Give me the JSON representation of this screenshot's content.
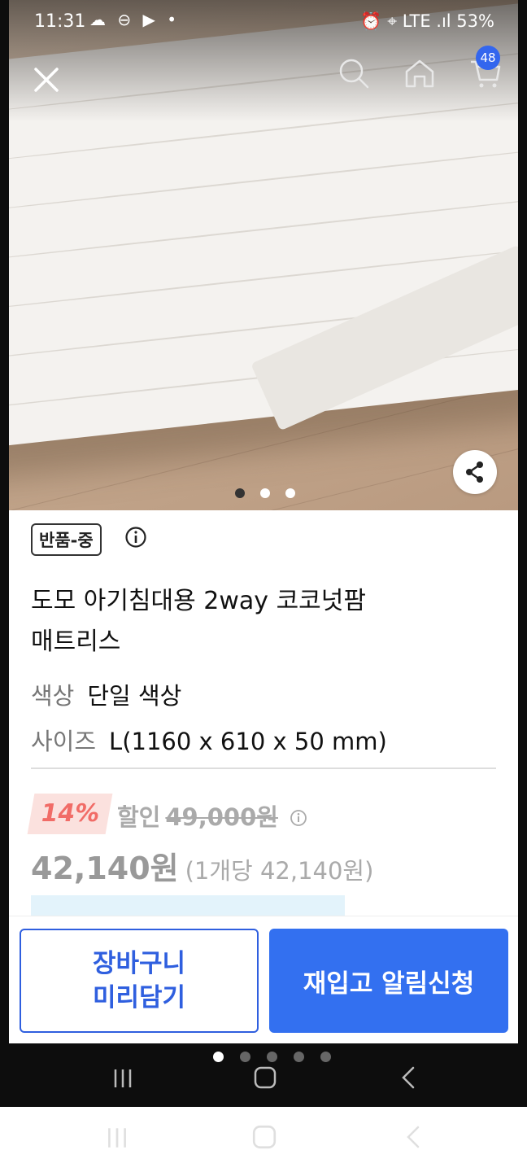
{
  "status_bar": {
    "time": "11:31",
    "left_icons": "☁ ⊖ ▶ •",
    "right_text": "⏰ ⌖ LTE .ıl 53%"
  },
  "gallery": {
    "dots": 3,
    "active_dot": 1
  },
  "header": {
    "cart_count": "48"
  },
  "product": {
    "badge": "반품-중",
    "title_line1": "도모 아기침대용 2way 코코넛팜",
    "title_line2": "매트리스",
    "color_key": "색상",
    "color_value": "단일 색상",
    "size_key": "사이즈",
    "size_value": "L(1160 x 610 x 50 mm)"
  },
  "pricing": {
    "discount": "14%",
    "discount_label": "할인",
    "original_price": "49,000원",
    "price": "42,140원",
    "unit_price": "(1개당 42,140원)"
  },
  "actions": {
    "cart_line1": "장바구니",
    "cart_line2": "미리담기",
    "restock_alert": "재입고 알림신청"
  },
  "colors": {
    "accent": "#3370f0",
    "discount": "#f16c67",
    "discount_bg": "#fbe1de"
  }
}
